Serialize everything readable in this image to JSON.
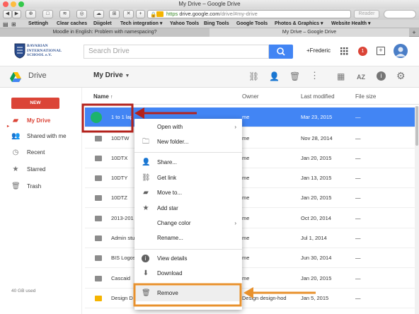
{
  "window": {
    "title": "My Drive – Google Drive"
  },
  "browser": {
    "toolbar_buttons": [
      "◀",
      "▶",
      "⊕",
      "□",
      "≋",
      "◎",
      "☁",
      "⊞",
      "✕",
      "✕"
    ],
    "new_tab_label": "+",
    "url_prefix": "https",
    "url_host": "drive.google.com",
    "url_path": "/drive/#my-drive",
    "reader_label": "Reader",
    "bookmarks": [
      "Settingh",
      "Clear caches",
      "Diigolet",
      "Tech integration ▾",
      "Yahoo Tools",
      "Bing Tools",
      "Google Tools",
      "Photos & Graphics ▾",
      "Website Health ▾"
    ],
    "tabs": [
      {
        "label": "Moodle in English: Problem with namespacing?"
      },
      {
        "label": "My Drive – Google Drive"
      }
    ]
  },
  "header": {
    "school_name": "BAVARIAN INTERNATIONAL SCHOOL e.V.",
    "search_placeholder": "Search Drive",
    "user_label": "+Frederic",
    "notification_count": "1"
  },
  "appbar": {
    "product_name": "Drive",
    "location_label": "My Drive"
  },
  "sidebar": {
    "new_label": "NEW",
    "items": [
      {
        "label": "My Drive",
        "icon": "drive-folder-icon"
      },
      {
        "label": "Shared with me",
        "icon": "people-icon"
      },
      {
        "label": "Recent",
        "icon": "clock-icon"
      },
      {
        "label": "Starred",
        "icon": "star-icon"
      },
      {
        "label": "Trash",
        "icon": "trash-icon"
      }
    ],
    "storage": "40 GB used"
  },
  "list": {
    "columns": {
      "name": "Name",
      "owner": "Owner",
      "modified": "Last modified",
      "size": "File size"
    },
    "rows": [
      {
        "name": "1 to 1 lap",
        "owner": "me",
        "modified": "Mar 23, 2015",
        "size": "—"
      },
      {
        "name": "10DTW",
        "owner": "me",
        "modified": "Nov 28, 2014",
        "size": "—"
      },
      {
        "name": "10DTX",
        "owner": "me",
        "modified": "Jan 20, 2015",
        "size": "—"
      },
      {
        "name": "10DTY",
        "owner": "me",
        "modified": "Jan 13, 2015",
        "size": "—"
      },
      {
        "name": "10DTZ",
        "owner": "me",
        "modified": "Jan 20, 2015",
        "size": "—"
      },
      {
        "name": "2013-201",
        "owner": "me",
        "modified": "Oct 20, 2014",
        "size": "—"
      },
      {
        "name": "Admin stu",
        "owner": "me",
        "modified": "Jul 1, 2014",
        "size": "—"
      },
      {
        "name": "BIS Logos",
        "owner": "me",
        "modified": "Jun 30, 2014",
        "size": "—"
      },
      {
        "name": "Cascaid",
        "owner": "me",
        "modified": "Jan 20, 2015",
        "size": "—"
      },
      {
        "name": "Design D",
        "owner": "Design design-hod",
        "modified": "Jan 5, 2015",
        "size": "—"
      }
    ]
  },
  "context_menu": {
    "items": [
      {
        "label": "Open with",
        "icon": "open-with-icon",
        "sub": "›"
      },
      {
        "label": "New folder...",
        "icon": "new-folder-icon",
        "sub": ""
      },
      {
        "label": "Share...",
        "icon": "share-icon",
        "sub": ""
      },
      {
        "label": "Get link",
        "icon": "link-icon",
        "sub": ""
      },
      {
        "label": "Move to...",
        "icon": "move-to-icon",
        "sub": ""
      },
      {
        "label": "Add star",
        "icon": "star-icon",
        "sub": ""
      },
      {
        "label": "Change color",
        "icon": "color-icon",
        "sub": "›"
      },
      {
        "label": "Rename...",
        "icon": "rename-icon",
        "sub": ""
      },
      {
        "label": "View details",
        "icon": "info-icon",
        "sub": ""
      },
      {
        "label": "Download",
        "icon": "download-icon",
        "sub": ""
      },
      {
        "label": "Remove",
        "icon": "trash-icon",
        "sub": ""
      }
    ]
  },
  "colors": {
    "accent": "#4285f4",
    "new_button": "#db4437",
    "annotation_red": "#b3221c",
    "annotation_orange": "#e8912d"
  }
}
